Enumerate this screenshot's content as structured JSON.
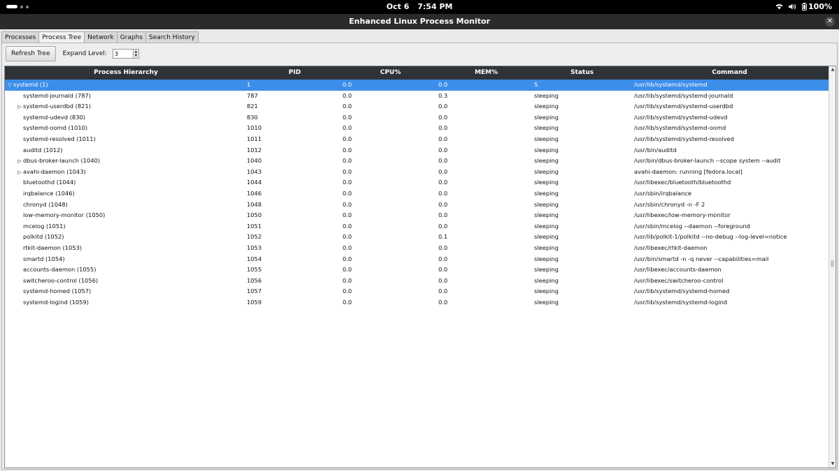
{
  "topbar": {
    "date": "Oct 6",
    "time": "7:54 PM",
    "battery": "100%",
    "icons": [
      "wifi-icon",
      "volume-icon",
      "battery-icon"
    ]
  },
  "window": {
    "title": "Enhanced Linux Process Monitor",
    "close_glyph": "✕"
  },
  "tabs": [
    {
      "label": "Processes",
      "active": false
    },
    {
      "label": "Process Tree",
      "active": true
    },
    {
      "label": "Network",
      "active": false
    },
    {
      "label": "Graphs",
      "active": false
    },
    {
      "label": "Search History",
      "active": false
    }
  ],
  "toolbar": {
    "refresh_label": "Refresh Tree",
    "expand_label": "Expand Level:",
    "expand_value": "3"
  },
  "table": {
    "columns": [
      "Process Hierarchy",
      "PID",
      "CPU%",
      "MEM%",
      "Status",
      "Command"
    ],
    "rows": [
      {
        "exp": "▽",
        "indent": 0,
        "name": "systemd (1)",
        "pid": "1",
        "cpu": "0.0",
        "mem": "0.0",
        "status": "S",
        "cmd": "/usr/lib/systemd/systemd",
        "selected": true
      },
      {
        "exp": "",
        "indent": 1,
        "name": "systemd-journald (787)",
        "pid": "787",
        "cpu": "0.0",
        "mem": "0.3",
        "status": "sleeping",
        "cmd": "/usr/lib/systemd/systemd-journald"
      },
      {
        "exp": "▷",
        "indent": 1,
        "name": "systemd-userdbd (821)",
        "pid": "821",
        "cpu": "0.0",
        "mem": "0.0",
        "status": "sleeping",
        "cmd": "/usr/lib/systemd/systemd-userdbd"
      },
      {
        "exp": "",
        "indent": 1,
        "name": "systemd-udevd (830)",
        "pid": "830",
        "cpu": "0.0",
        "mem": "0.0",
        "status": "sleeping",
        "cmd": "/usr/lib/systemd/systemd-udevd"
      },
      {
        "exp": "",
        "indent": 1,
        "name": "systemd-oomd (1010)",
        "pid": "1010",
        "cpu": "0.0",
        "mem": "0.0",
        "status": "sleeping",
        "cmd": "/usr/lib/systemd/systemd-oomd"
      },
      {
        "exp": "",
        "indent": 1,
        "name": "systemd-resolved (1011)",
        "pid": "1011",
        "cpu": "0.0",
        "mem": "0.0",
        "status": "sleeping",
        "cmd": "/usr/lib/systemd/systemd-resolved"
      },
      {
        "exp": "",
        "indent": 1,
        "name": "auditd (1012)",
        "pid": "1012",
        "cpu": "0.0",
        "mem": "0.0",
        "status": "sleeping",
        "cmd": "/usr/bin/auditd"
      },
      {
        "exp": "▷",
        "indent": 1,
        "name": "dbus-broker-launch (1040)",
        "pid": "1040",
        "cpu": "0.0",
        "mem": "0.0",
        "status": "sleeping",
        "cmd": "/usr/bin/dbus-broker-launch --scope system --audit"
      },
      {
        "exp": "▷",
        "indent": 1,
        "name": "avahi-daemon (1043)",
        "pid": "1043",
        "cpu": "0.0",
        "mem": "0.0",
        "status": "sleeping",
        "cmd": "avahi-daemon: running [fedora.local]"
      },
      {
        "exp": "",
        "indent": 1,
        "name": "bluetoothd (1044)",
        "pid": "1044",
        "cpu": "0.0",
        "mem": "0.0",
        "status": "sleeping",
        "cmd": "/usr/libexec/bluetooth/bluetoothd"
      },
      {
        "exp": "",
        "indent": 1,
        "name": "irqbalance (1046)",
        "pid": "1046",
        "cpu": "0.0",
        "mem": "0.0",
        "status": "sleeping",
        "cmd": "/usr/sbin/irqbalance"
      },
      {
        "exp": "",
        "indent": 1,
        "name": "chronyd (1048)",
        "pid": "1048",
        "cpu": "0.0",
        "mem": "0.0",
        "status": "sleeping",
        "cmd": "/usr/sbin/chronyd -n -F 2"
      },
      {
        "exp": "",
        "indent": 1,
        "name": "low-memory-monitor (1050)",
        "pid": "1050",
        "cpu": "0.0",
        "mem": "0.0",
        "status": "sleeping",
        "cmd": "/usr/libexec/low-memory-monitor"
      },
      {
        "exp": "",
        "indent": 1,
        "name": "mcelog (1051)",
        "pid": "1051",
        "cpu": "0.0",
        "mem": "0.0",
        "status": "sleeping",
        "cmd": "/usr/sbin/mcelog --daemon --foreground"
      },
      {
        "exp": "",
        "indent": 1,
        "name": "polkitd (1052)",
        "pid": "1052",
        "cpu": "0.0",
        "mem": "0.1",
        "status": "sleeping",
        "cmd": "/usr/lib/polkit-1/polkitd --no-debug --log-level=notice"
      },
      {
        "exp": "",
        "indent": 1,
        "name": "rtkit-daemon (1053)",
        "pid": "1053",
        "cpu": "0.0",
        "mem": "0.0",
        "status": "sleeping",
        "cmd": "/usr/libexec/rtkit-daemon"
      },
      {
        "exp": "",
        "indent": 1,
        "name": "smartd (1054)",
        "pid": "1054",
        "cpu": "0.0",
        "mem": "0.0",
        "status": "sleeping",
        "cmd": "/usr/bin/smartd -n -q never --capabilities=mail"
      },
      {
        "exp": "",
        "indent": 1,
        "name": "accounts-daemon (1055)",
        "pid": "1055",
        "cpu": "0.0",
        "mem": "0.0",
        "status": "sleeping",
        "cmd": "/usr/libexec/accounts-daemon"
      },
      {
        "exp": "",
        "indent": 1,
        "name": "switcheroo-control (1056)",
        "pid": "1056",
        "cpu": "0.0",
        "mem": "0.0",
        "status": "sleeping",
        "cmd": "/usr/libexec/switcheroo-control"
      },
      {
        "exp": "",
        "indent": 1,
        "name": "systemd-homed (1057)",
        "pid": "1057",
        "cpu": "0.0",
        "mem": "0.0",
        "status": "sleeping",
        "cmd": "/usr/lib/systemd/systemd-homed"
      },
      {
        "exp": "",
        "indent": 1,
        "name": "systemd-logind (1059)",
        "pid": "1059",
        "cpu": "0.0",
        "mem": "0.0",
        "status": "sleeping",
        "cmd": "/usr/lib/systemd/systemd-logind"
      }
    ]
  },
  "colors": {
    "header_bg": "#2f3337",
    "selection": "#3d8ee9",
    "titlebar": "#2b2b2b"
  }
}
